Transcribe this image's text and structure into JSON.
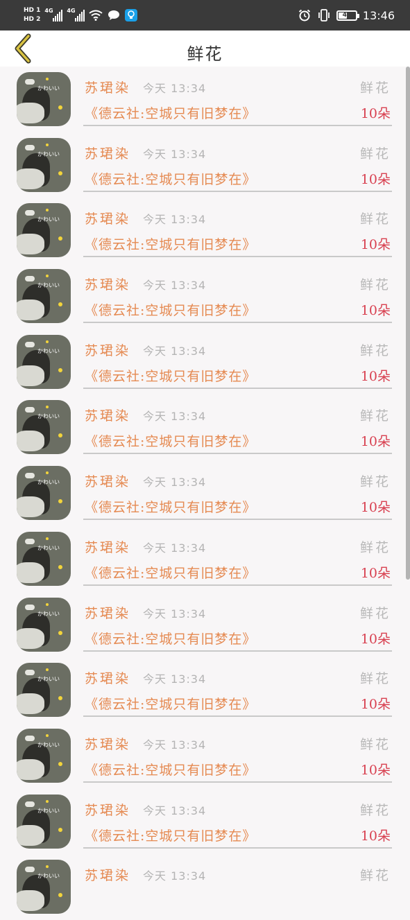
{
  "status_bar": {
    "hd1": "HD 1",
    "hd2": "HD 2",
    "net1": "4G",
    "net2": "4G",
    "battery": "48",
    "time": "13:46"
  },
  "header": {
    "title": "鲜花"
  },
  "rows": [
    {
      "name": "苏珺染",
      "time": "今天 13:34",
      "gift": "鲜花",
      "program": "《德云社:空城只有旧梦在》",
      "count": "10朵"
    },
    {
      "name": "苏珺染",
      "time": "今天 13:34",
      "gift": "鲜花",
      "program": "《德云社:空城只有旧梦在》",
      "count": "10朵"
    },
    {
      "name": "苏珺染",
      "time": "今天 13:34",
      "gift": "鲜花",
      "program": "《德云社:空城只有旧梦在》",
      "count": "10朵"
    },
    {
      "name": "苏珺染",
      "time": "今天 13:34",
      "gift": "鲜花",
      "program": "《德云社:空城只有旧梦在》",
      "count": "10朵"
    },
    {
      "name": "苏珺染",
      "time": "今天 13:34",
      "gift": "鲜花",
      "program": "《德云社:空城只有旧梦在》",
      "count": "10朵"
    },
    {
      "name": "苏珺染",
      "time": "今天 13:34",
      "gift": "鲜花",
      "program": "《德云社:空城只有旧梦在》",
      "count": "10朵"
    },
    {
      "name": "苏珺染",
      "time": "今天 13:34",
      "gift": "鲜花",
      "program": "《德云社:空城只有旧梦在》",
      "count": "10朵"
    },
    {
      "name": "苏珺染",
      "time": "今天 13:34",
      "gift": "鲜花",
      "program": "《德云社:空城只有旧梦在》",
      "count": "10朵"
    },
    {
      "name": "苏珺染",
      "time": "今天 13:34",
      "gift": "鲜花",
      "program": "《德云社:空城只有旧梦在》",
      "count": "10朵"
    },
    {
      "name": "苏珺染",
      "time": "今天 13:34",
      "gift": "鲜花",
      "program": "《德云社:空城只有旧梦在》",
      "count": "10朵"
    },
    {
      "name": "苏珺染",
      "time": "今天 13:34",
      "gift": "鲜花",
      "program": "《德云社:空城只有旧梦在》",
      "count": "10朵"
    },
    {
      "name": "苏珺染",
      "time": "今天 13:34",
      "gift": "鲜花",
      "program": "《德云社:空城只有旧梦在》",
      "count": "10朵"
    },
    {
      "name": "苏珺染",
      "time": "今天 13:34",
      "gift": "鲜花",
      "program": "",
      "count": ""
    }
  ],
  "avatar_caption": "かわいい",
  "icons": {
    "back": "chevron-left-icon",
    "wifi": "wifi-icon",
    "message": "chat-bubble-icon",
    "app": "lightbulb-icon",
    "alarm": "alarm-icon",
    "vibrate": "vibrate-icon",
    "battery": "battery-icon"
  },
  "colors": {
    "status_bar_bg": "#3a3a3a",
    "name_color": "#e58a52",
    "count_color": "#d84050",
    "muted": "#b4b4b4",
    "back_icon": "#d9c342"
  }
}
